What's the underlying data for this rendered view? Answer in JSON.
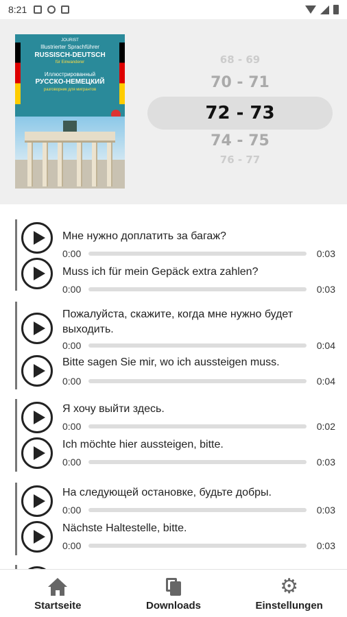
{
  "status_bar": {
    "time": "8:21"
  },
  "cover": {
    "line1": "JOURIST",
    "line2": "Illustrierter Sprachführer",
    "line3": "RUSSISCH-DEUTSCH",
    "line4": "für Einwanderer",
    "line5": "Иллюстрированный",
    "line6": "РУССКО-НЕМЕЦКИЙ",
    "line7": "разговорник для мигрантов"
  },
  "picker": {
    "items": [
      "68 - 69",
      "70 - 71",
      "72 - 73",
      "74 - 75",
      "76 - 77"
    ],
    "selected": "72 - 73"
  },
  "groups": [
    {
      "tracks": [
        {
          "text": "Мне нужно доплатить за багаж?",
          "current": "0:00",
          "duration": "0:03"
        },
        {
          "text": "Muss ich für mein Gepäck extra zahlen?",
          "current": "0:00",
          "duration": "0:03"
        }
      ]
    },
    {
      "tracks": [
        {
          "text": "Пожалуйста, скажите, когда мне нужно будет выходить.",
          "current": "0:00",
          "duration": "0:04"
        },
        {
          "text": "Bitte sagen Sie mir, wo ich aussteigen muss.",
          "current": "0:00",
          "duration": "0:04"
        }
      ]
    },
    {
      "tracks": [
        {
          "text": "Я хочу выйти здесь.",
          "current": "0:00",
          "duration": "0:02"
        },
        {
          "text": "Ich möchte hier aussteigen, bitte.",
          "current": "0:00",
          "duration": "0:03"
        }
      ]
    },
    {
      "tracks": [
        {
          "text": "На следующей остановке, будьте добры.",
          "current": "0:00",
          "duration": "0:03"
        },
        {
          "text": "Nächste Haltestelle, bitte.",
          "current": "0:00",
          "duration": "0:03"
        }
      ]
    }
  ],
  "nav": {
    "home": "Startseite",
    "downloads": "Downloads",
    "settings": "Einstellungen"
  }
}
